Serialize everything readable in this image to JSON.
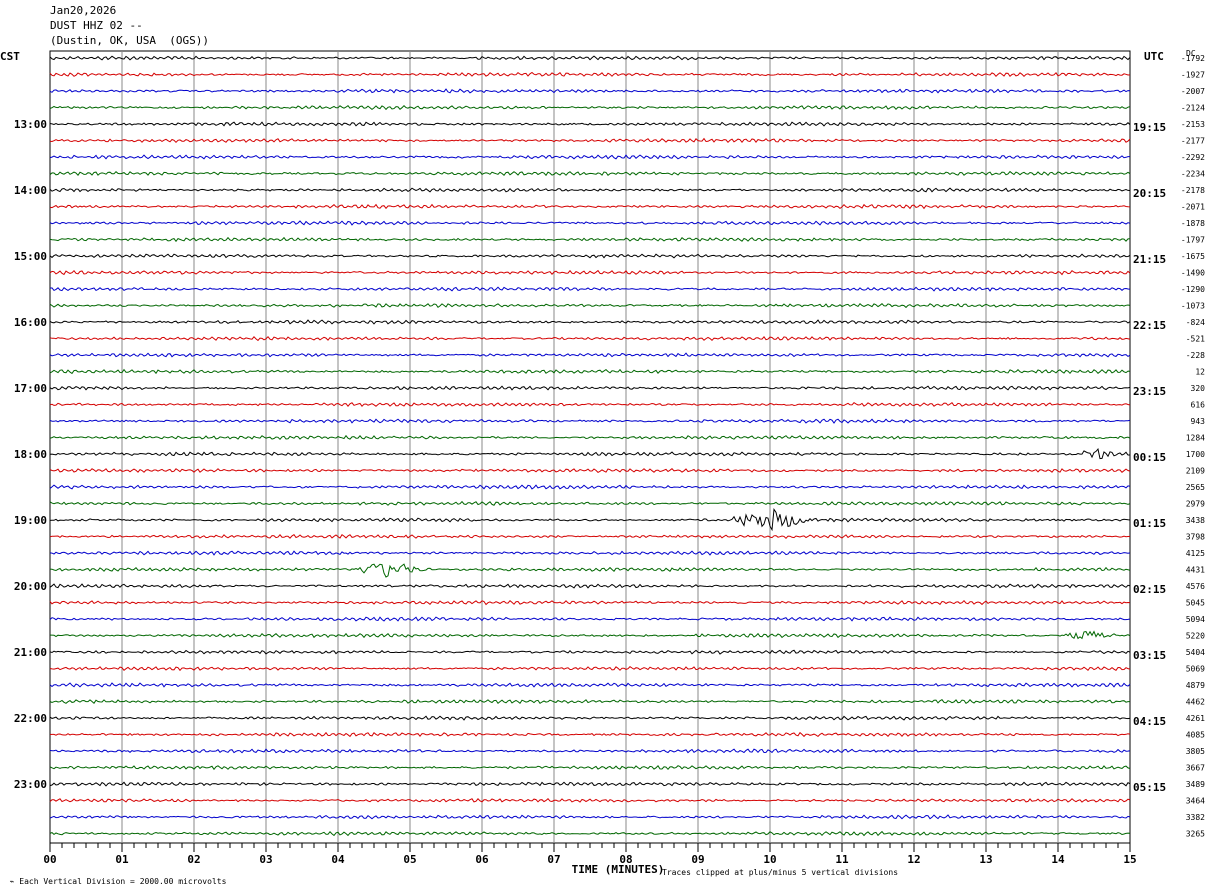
{
  "header": {
    "date": "Jan20,2026",
    "station": "DUST HHZ 02 --",
    "location": "(Dustin, OK, USA  (OGS))"
  },
  "left_tz": "CST",
  "right_tz": "UTC",
  "dc_label": "DC",
  "footer": {
    "scale": "Each Vertical Division = 2000.00 microvolts",
    "clip": "Traces clipped at plus/minus 5 vertical divisions"
  },
  "colors": {
    "trace": [
      "#000000",
      "#d40000",
      "#0000cc",
      "#006600"
    ],
    "grid": "#888888"
  },
  "chart_data": {
    "type": "line",
    "title": "DUST HHZ 02 --",
    "xlabel": "TIME (MINUTES)",
    "x_ticks": [
      "00",
      "01",
      "02",
      "03",
      "04",
      "05",
      "06",
      "07",
      "08",
      "09",
      "10",
      "11",
      "12",
      "13",
      "14",
      "15"
    ],
    "xlim": [
      0,
      15
    ],
    "trace_count": 48,
    "left_hour_labels": [
      "13:00",
      "14:00",
      "15:00",
      "16:00",
      "17:00",
      "18:00",
      "19:00",
      "20:00",
      "21:00",
      "22:00",
      "23:00"
    ],
    "right_hour_labels": [
      "19:15",
      "20:15",
      "21:15",
      "22:15",
      "23:15",
      "00:15",
      "01:15",
      "02:15",
      "03:15",
      "04:15",
      "05:15"
    ],
    "dc_offsets": [
      "-1792",
      "-1927",
      "-2007",
      "-2124",
      "-2153",
      "-2177",
      "-2292",
      "-2234",
      "-2178",
      "-2071",
      "-1878",
      "-1797",
      "-1675",
      "-1490",
      "-1290",
      "-1073",
      "-824",
      "-521",
      "-228",
      "12",
      "320",
      "616",
      "943",
      "1284",
      "1700",
      "2109",
      "2565",
      "2979",
      "3438",
      "3798",
      "4125",
      "4431",
      "4576",
      "5045",
      "5094",
      "5220",
      "5404",
      "5069",
      "4879",
      "4462",
      "4261",
      "4085",
      "3805",
      "3667",
      "3489",
      "3464",
      "3382",
      "3265"
    ],
    "events": [
      {
        "trace": 28,
        "start_min": 9.5,
        "end_min": 11.0,
        "amplitude": 2.5
      },
      {
        "trace": 31,
        "start_min": 4.2,
        "end_min": 5.5,
        "amplitude": 2.0
      },
      {
        "trace": 24,
        "start_min": 14.2,
        "end_min": 15.0,
        "amplitude": 1.2
      },
      {
        "trace": 35,
        "start_min": 14.1,
        "end_min": 15.0,
        "amplitude": 1.2
      }
    ]
  }
}
